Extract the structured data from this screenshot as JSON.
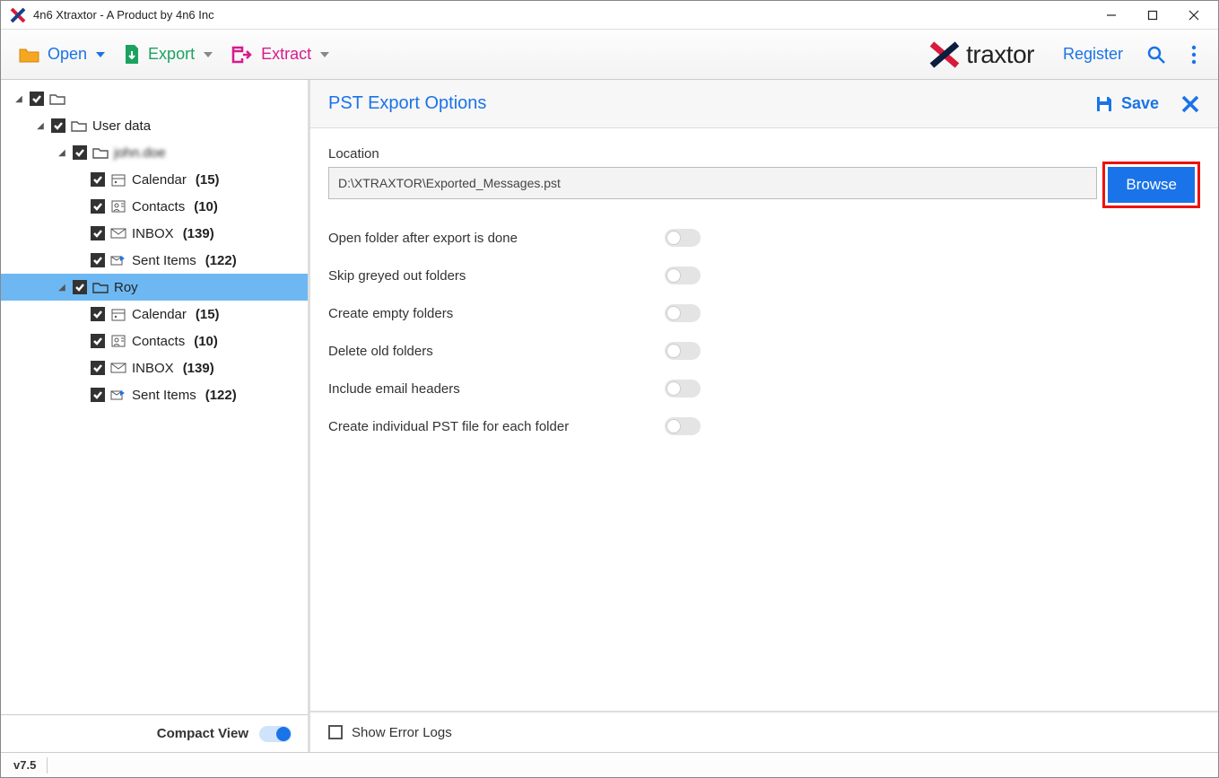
{
  "window": {
    "title": "4n6 Xtraxtor - A Product by 4n6 Inc"
  },
  "toolbar": {
    "open": "Open",
    "export": "Export",
    "extract": "Extract",
    "brand": "traxtor",
    "register": "Register"
  },
  "tree": {
    "root": "",
    "userdata": "User data",
    "account_blurred": "john.doe",
    "calendar": "Calendar",
    "calendar_count": "(15)",
    "contacts": "Contacts",
    "contacts_count": "(10)",
    "inbox": "INBOX",
    "inbox_count": "(139)",
    "sent": "Sent Items",
    "sent_count": "(122)",
    "roy": "Roy",
    "calendar2": "Calendar",
    "calendar2_count": "(15)",
    "contacts2": "Contacts",
    "contacts2_count": "(10)",
    "inbox2": "INBOX",
    "inbox2_count": "(139)",
    "sent2": "Sent Items",
    "sent2_count": "(122)"
  },
  "sidebar_footer": {
    "compact": "Compact View"
  },
  "export_panel": {
    "title": "PST Export Options",
    "save": "Save",
    "location_label": "Location",
    "location_value": "D:\\XTRAXTOR\\Exported_Messages.pst",
    "browse": "Browse",
    "opt_open_folder": "Open folder after export is done",
    "opt_skip_greyed": "Skip greyed out folders",
    "opt_create_empty": "Create empty folders",
    "opt_delete_old": "Delete old folders",
    "opt_include_headers": "Include email headers",
    "opt_individual_pst": "Create individual PST file for each folder",
    "show_error_logs": "Show Error Logs"
  },
  "status": {
    "version": "v7.5"
  }
}
